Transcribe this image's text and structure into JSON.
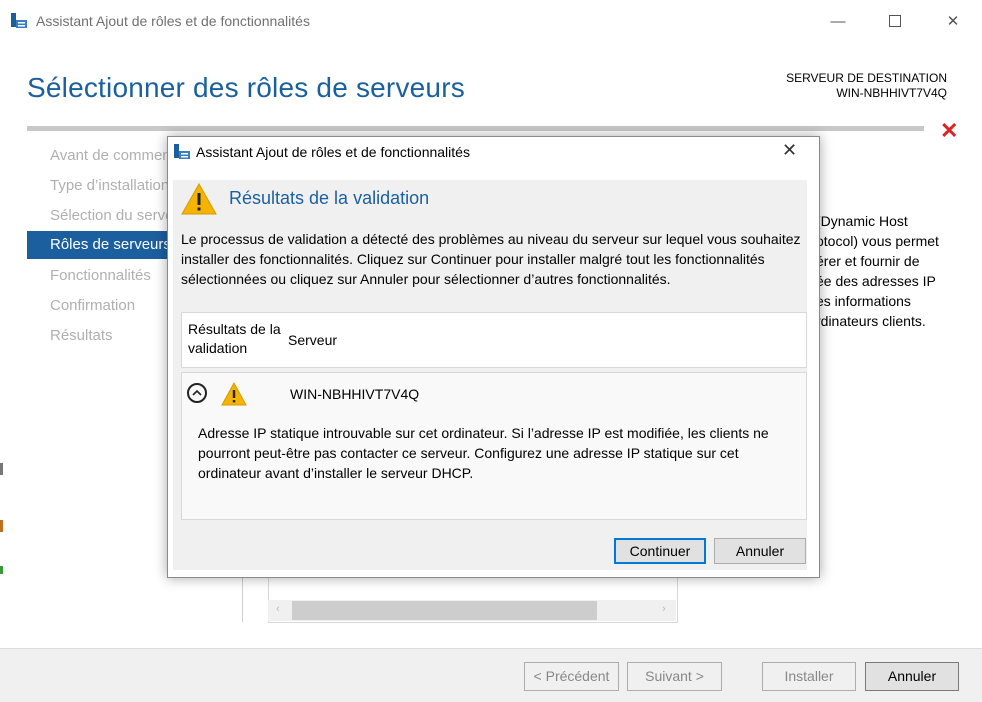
{
  "main_window": {
    "title": "Assistant Ajout de rôles et de fonctionnalités",
    "heading": "Sélectionner des rôles de serveurs",
    "destination_label": "SERVEUR DE DESTINATION",
    "destination_server": "WIN-NBHHIVT7V4Q",
    "nav": [
      {
        "label": "Avant de commencer",
        "active": false
      },
      {
        "label": "Type d’installation",
        "active": false
      },
      {
        "label": "Sélection du serveur",
        "active": false
      },
      {
        "label": "Rôles de serveurs",
        "active": true
      },
      {
        "label": "Fonctionnalités",
        "active": false
      },
      {
        "label": "Confirmation",
        "active": false
      },
      {
        "label": "Résultats",
        "active": false
      }
    ],
    "description_lines": [
      "(Dynamic Host",
      "otocol) vous permet",
      "érer et fournir de",
      "ée des adresses IP",
      "es informations",
      "rdinateurs clients."
    ],
    "footer": {
      "prev": "< Précédent",
      "next": "Suivant >",
      "install": "Installer",
      "cancel": "Annuler"
    }
  },
  "dialog": {
    "title": "Assistant Ajout de rôles et de fonctionnalités",
    "heading": "Résultats de la validation",
    "message": "Le processus de validation a détecté des problèmes au niveau du serveur sur lequel vous souhaitez installer des fonctionnalités. Cliquez sur Continuer pour installer malgré tout les fonctionnalités sélectionnées ou cliquez sur Annuler pour sélectionner d’autres fonctionnalités.",
    "columns": {
      "results": "Résultats de la validation",
      "server": "Serveur"
    },
    "row": {
      "server": "WIN-NBHHIVT7V4Q",
      "detail": "Adresse IP statique introuvable sur cet ordinateur. Si l’adresse IP est modifiée, les clients ne pourront peut-être pas contacter ce serveur. Configurez une adresse IP statique sur cet ordinateur avant d’installer le serveur DHCP."
    },
    "buttons": {
      "continue": "Continuer",
      "cancel": "Annuler"
    }
  },
  "colors": {
    "accent": "#1c5f9e",
    "error": "#e02020",
    "warning": "#f5b400"
  },
  "icons": [
    "server-manager-icon",
    "warning-icon",
    "close-icon",
    "minimize-icon",
    "maximize-icon",
    "error-icon",
    "collapse-icon"
  ]
}
